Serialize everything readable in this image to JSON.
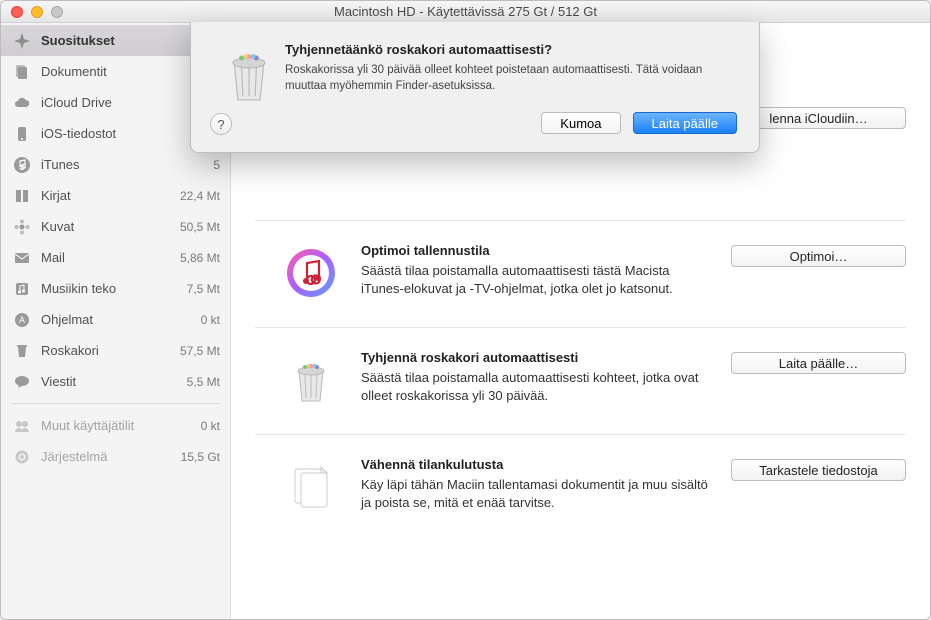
{
  "window": {
    "title": "Macintosh HD - Käytettävissä 275 Gt / 512 Gt"
  },
  "sidebar": {
    "items": [
      {
        "label": "Suositukset",
        "size": "",
        "icon": "sparkle-icon",
        "selected": true
      },
      {
        "label": "Dokumentit",
        "size": "",
        "icon": "documents-icon"
      },
      {
        "label": "iCloud Drive",
        "size": "",
        "icon": "cloud-icon"
      },
      {
        "label": "iOS-tiedostot",
        "size": "",
        "icon": "phone-icon"
      },
      {
        "label": "iTunes",
        "size": "5",
        "icon": "note-icon"
      },
      {
        "label": "Kirjat",
        "size": "22,4 Mt",
        "icon": "book-icon"
      },
      {
        "label": "Kuvat",
        "size": "50,5 Mt",
        "icon": "flower-icon"
      },
      {
        "label": "Mail",
        "size": "5,86 Mt",
        "icon": "envelope-icon"
      },
      {
        "label": "Musiikin teko",
        "size": "7,5 Mt",
        "icon": "music-icon"
      },
      {
        "label": "Ohjelmat",
        "size": "0 kt",
        "icon": "apps-icon"
      },
      {
        "label": "Roskakori",
        "size": "57,5 Mt",
        "icon": "trash-icon"
      },
      {
        "label": "Viestit",
        "size": "5,5 Mt",
        "icon": "chat-icon"
      }
    ],
    "footer": [
      {
        "label": "Muut käyttäjätilit",
        "size": "0 kt",
        "icon": "users-icon"
      },
      {
        "label": "Järjestelmä",
        "size": "15,5 Gt",
        "icon": "gear-icon"
      }
    ]
  },
  "recommendations": [
    {
      "title": "",
      "desc": "",
      "button": "lenna iCloudiin…",
      "icon": "icloud-big-icon"
    },
    {
      "title": "Optimoi tallennustila",
      "desc": "Säästä tilaa poistamalla automaattisesti tästä Macista iTunes-elokuvat ja -TV-ohjelmat, jotka olet jo katsonut.",
      "button": "Optimoi…",
      "icon": "itunes-big-icon"
    },
    {
      "title": "Tyhjennä roskakori automaattisesti",
      "desc": "Säästä tilaa poistamalla automaattisesti kohteet, jotka ovat olleet roskakorissa yli 30 päivää.",
      "button": "Laita päälle…",
      "icon": "trash-big-icon"
    },
    {
      "title": "Vähennä tilankulutusta",
      "desc": "Käy läpi tähän Maciin tallentamasi dokumentit ja muu sisältö ja poista se, mitä et enää tarvitse.",
      "button": "Tarkastele tiedostoja",
      "icon": "docs-big-icon"
    }
  ],
  "dialog": {
    "title": "Tyhjennetäänkö roskakori automaattisesti?",
    "message": "Roskakorissa yli 30 päivää olleet kohteet poistetaan automaattisesti. Tätä voidaan muuttaa myöhemmin Finder-asetuksissa.",
    "cancel": "Kumoa",
    "confirm": "Laita päälle",
    "help": "?"
  }
}
